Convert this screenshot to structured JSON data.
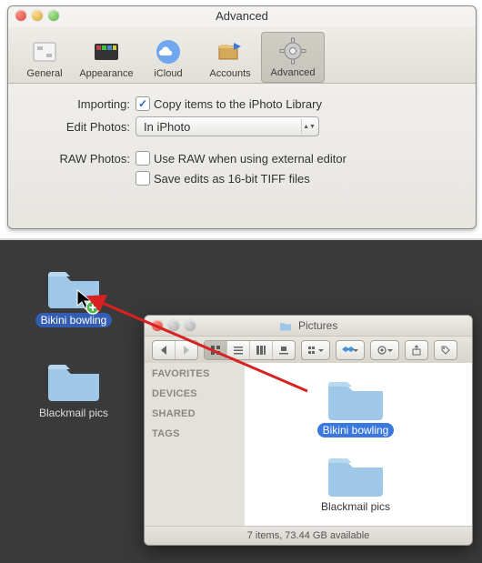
{
  "prefs": {
    "title": "Advanced",
    "tabs": [
      {
        "label": "General"
      },
      {
        "label": "Appearance"
      },
      {
        "label": "iCloud"
      },
      {
        "label": "Accounts"
      },
      {
        "label": "Advanced"
      }
    ],
    "importing_label": "Importing:",
    "importing_checkbox": "Copy items to the iPhoto Library",
    "edit_label": "Edit Photos:",
    "edit_value": "In iPhoto",
    "raw_label": "RAW Photos:",
    "raw_checkbox1": "Use RAW when using external editor",
    "raw_checkbox2": "Save edits as 16-bit TIFF files"
  },
  "desk": {
    "item1": "Bikini bowling",
    "item2": "Blackmail pics"
  },
  "finder": {
    "title": "Pictures",
    "sidebar": {
      "favorites": "FAVORITES",
      "devices": "DEVICES",
      "shared": "SHARED",
      "tags": "TAGS"
    },
    "item1": "Bikini bowling",
    "item2": "Blackmail pics",
    "status": "7 items, 73.44 GB available"
  }
}
